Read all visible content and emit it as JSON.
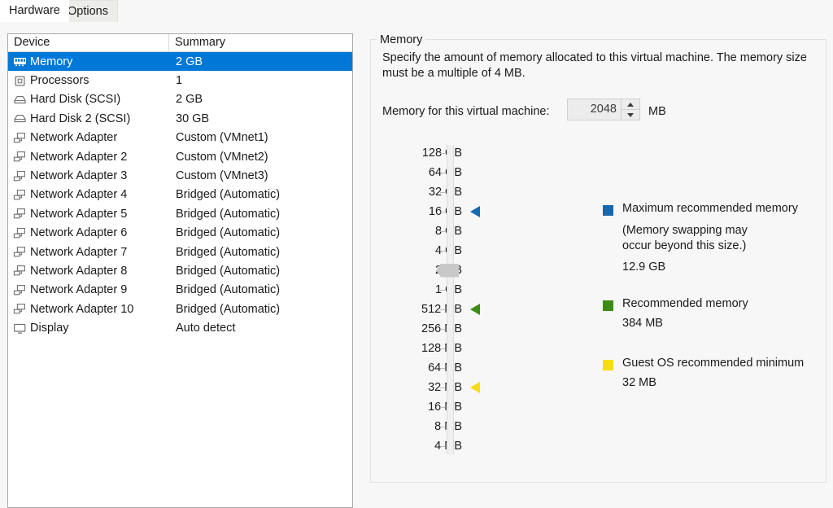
{
  "tabs": [
    {
      "label": "Hardware",
      "active": true
    },
    {
      "label": "Options",
      "active": false
    }
  ],
  "device_list": {
    "columns": {
      "device": "Device",
      "summary": "Summary"
    },
    "rows": [
      {
        "icon": "memory-icon",
        "device": "Memory",
        "summary": "2 GB",
        "selected": true
      },
      {
        "icon": "processor-icon",
        "device": "Processors",
        "summary": "1",
        "selected": false
      },
      {
        "icon": "hard-disk-icon",
        "device": "Hard Disk (SCSI)",
        "summary": "2 GB",
        "selected": false
      },
      {
        "icon": "hard-disk-icon",
        "device": "Hard Disk 2 (SCSI)",
        "summary": "30 GB",
        "selected": false
      },
      {
        "icon": "network-adapter-icon",
        "device": "Network Adapter",
        "summary": "Custom (VMnet1)",
        "selected": false
      },
      {
        "icon": "network-adapter-icon",
        "device": "Network Adapter 2",
        "summary": "Custom (VMnet2)",
        "selected": false
      },
      {
        "icon": "network-adapter-icon",
        "device": "Network Adapter 3",
        "summary": "Custom (VMnet3)",
        "selected": false
      },
      {
        "icon": "network-adapter-icon",
        "device": "Network Adapter 4",
        "summary": "Bridged (Automatic)",
        "selected": false
      },
      {
        "icon": "network-adapter-icon",
        "device": "Network Adapter 5",
        "summary": "Bridged (Automatic)",
        "selected": false
      },
      {
        "icon": "network-adapter-icon",
        "device": "Network Adapter 6",
        "summary": "Bridged (Automatic)",
        "selected": false
      },
      {
        "icon": "network-adapter-icon",
        "device": "Network Adapter 7",
        "summary": "Bridged (Automatic)",
        "selected": false
      },
      {
        "icon": "network-adapter-icon",
        "device": "Network Adapter 8",
        "summary": "Bridged (Automatic)",
        "selected": false
      },
      {
        "icon": "network-adapter-icon",
        "device": "Network Adapter 9",
        "summary": "Bridged (Automatic)",
        "selected": false
      },
      {
        "icon": "network-adapter-icon",
        "device": "Network Adapter 10",
        "summary": "Bridged (Automatic)",
        "selected": false
      },
      {
        "icon": "display-icon",
        "device": "Display",
        "summary": "Auto detect",
        "selected": false
      }
    ]
  },
  "panel": {
    "group_title": "Memory",
    "description": "Specify the amount of memory allocated to this virtual machine. The memory size must be a multiple of 4 MB.",
    "memory_field_label": "Memory for this virtual machine:",
    "memory_value": "2048",
    "memory_unit": "MB",
    "scale_ticks": [
      "128 GB",
      "64 GB",
      "32 GB",
      "16 GB",
      "8 GB",
      "4 GB",
      "2 GB",
      "1 GB",
      "512 MB",
      "256 MB",
      "128 MB",
      "64 MB",
      "32 MB",
      "16 MB",
      "8 MB",
      "4 MB"
    ],
    "slider_thumb_tick": "2 GB",
    "markers": [
      {
        "name": "maximum-recommended-marker",
        "color": "#1668b0",
        "tick": "16 GB"
      },
      {
        "name": "recommended-marker",
        "color": "#3c8c14",
        "tick": "512 MB"
      },
      {
        "name": "guest-os-minimum-marker",
        "color": "#f5dc14",
        "tick": "32 MB"
      }
    ],
    "legend": [
      {
        "name": "maximum-recommended",
        "color": "#1668b0",
        "title": "Maximum recommended memory",
        "note_line1": "(Memory swapping may",
        "note_line2": "occur beyond this size.)",
        "value": "12.9 GB"
      },
      {
        "name": "recommended",
        "color": "#3c8c14",
        "title": "Recommended memory",
        "value": "384 MB"
      },
      {
        "name": "guest-os-minimum",
        "color": "#f5dc14",
        "title": "Guest OS recommended minimum",
        "value": "32 MB"
      }
    ]
  },
  "colors": {
    "selection": "#0078d7",
    "blue": "#1668b0",
    "green": "#3c8c14",
    "yellow": "#f5dc14"
  }
}
